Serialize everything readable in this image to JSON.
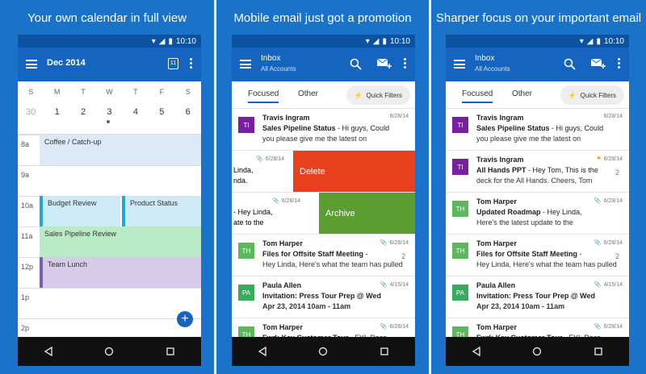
{
  "panels": [
    {
      "title": "Your own calendar in full view"
    },
    {
      "title": "Mobile email just got a promotion"
    },
    {
      "title": "Sharper focus on your important email"
    }
  ],
  "status_time": "10:10",
  "calendar": {
    "month": "Dec 2014",
    "today_badge": "11",
    "weekdays": [
      "S",
      "M",
      "T",
      "W",
      "T",
      "F",
      "S"
    ],
    "dates": [
      "30",
      "1",
      "2",
      "3",
      "4",
      "5",
      "6"
    ],
    "hours": [
      "8a",
      "9a",
      "10a",
      "11a",
      "12p",
      "1p",
      "2p"
    ],
    "events": {
      "e1": "Coffee / Catch-up",
      "e2": "Budget Review",
      "e3": "Product Status",
      "e4": "Sales Pipeline Review",
      "e5": "Team Lunch"
    },
    "fab": "+"
  },
  "inbox": {
    "title": "Inbox",
    "subtitle": "All Accounts",
    "tab_focused": "Focused",
    "tab_other": "Other",
    "quick_filters": "Quick Filters",
    "swipe_delete": "Delete",
    "swipe_archive": "Archive"
  },
  "msgs2": {
    "m1": {
      "initials": "TI",
      "from": "Travis Ingram",
      "subject": "Sales Pipeline Status",
      "preview_a": " - Hi guys, Could",
      "preview_b": "you please give me the latest on",
      "date": "6/28/14"
    },
    "m2": {
      "date": "6/28/14",
      "preview_a": "Linda,",
      "preview_b": "nda."
    },
    "m3": {
      "date": "6/28/14",
      "preview_a": "- Hey Linda,",
      "preview_b": "ate to the"
    },
    "m4": {
      "initials": "TH",
      "from": "Tom Harper",
      "subject": "Files for Offsite Staff Meeting",
      "preview_a": " -",
      "preview_b": "Hey Linda, Here's what the team has pulled",
      "date": "6/28/14",
      "count": "2"
    },
    "m5": {
      "initials": "PA",
      "from": "Paula Allen",
      "subject": "Invitation: Press Tour Prep @ Wed",
      "preview_b": "Apr 23, 2014 10am - 11am",
      "date": "4/15/14"
    },
    "m6": {
      "initials": "TH",
      "from": "Tom Harper",
      "subject": "Fwd: Key Customer Tour",
      "preview_a": " - FYI, Docs",
      "date": "6/28/14"
    }
  },
  "msgs3": {
    "m1": {
      "initials": "TI",
      "from": "Travis Ingram",
      "subject": "Sales Pipeline Status",
      "preview_a": " - Hi guys, Could",
      "preview_b": "you please give me the latest on",
      "date": "6/28/14"
    },
    "m2": {
      "initials": "TI",
      "from": "Travis Ingram",
      "subject": "All Hands PPT",
      "preview_a": " - Hey Tom, This is the",
      "preview_b": "deck for the All Hands. Cheers, Tom",
      "date": "6/28/14",
      "count": "2"
    },
    "m3": {
      "initials": "TH",
      "from": "Tom Harper",
      "subject": "Updated Roadmap",
      "preview_a": " - Hey Linda,",
      "preview_b": "Here's the latest update to the",
      "date": "6/28/14"
    },
    "m4": {
      "initials": "TH",
      "from": "Tom Harper",
      "subject": "Files for Offsite Staff Meeting",
      "preview_a": " -",
      "preview_b": "Hey Linda, Here's what the team has pulled",
      "date": "6/28/14",
      "count": "2"
    },
    "m5": {
      "initials": "PA",
      "from": "Paula Allen",
      "subject": "Invitation: Press Tour Prep @ Wed",
      "preview_b": "Apr 23, 2014 10am - 11am",
      "date": "4/15/14"
    },
    "m6": {
      "initials": "TH",
      "from": "Tom Harper",
      "subject": "Fwd: Key Customer Tour",
      "preview_a": " - FYI, Docs",
      "date": "6/28/14"
    }
  },
  "colors": {
    "panel_bg": "#1a73c9",
    "appbar": "#1565c0",
    "statusbar": "#0b52a0",
    "delete": "#e8401c",
    "archive": "#5a9e2f",
    "avatar_ti": "#7b1fa2",
    "avatar_th": "#5cb85c",
    "avatar_pa": "#3aaa5c",
    "flag": "#f0a030"
  }
}
